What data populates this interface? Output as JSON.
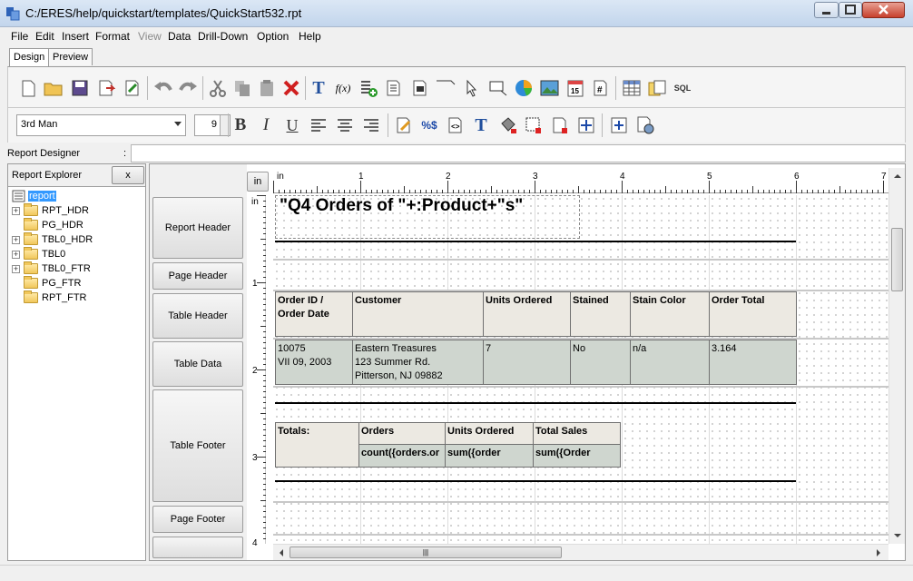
{
  "window": {
    "title": "C:/ERES/help/quickstart/templates/QuickStart532.rpt"
  },
  "menu": [
    {
      "label": "File",
      "enabled": true
    },
    {
      "label": "Edit",
      "enabled": true
    },
    {
      "label": "Insert",
      "enabled": true
    },
    {
      "label": "Format",
      "enabled": true
    },
    {
      "label": "View",
      "enabled": false
    },
    {
      "label": "Data",
      "enabled": true
    },
    {
      "label": "Drill-Down",
      "enabled": true
    },
    {
      "label": "Option",
      "enabled": true
    },
    {
      "label": "Help",
      "enabled": true
    }
  ],
  "tabs": [
    {
      "label": "Design",
      "active": true
    },
    {
      "label": "Preview",
      "active": false
    }
  ],
  "toolbar1": [
    "new-file-icon",
    "open-folder-icon",
    "save-icon",
    "export-icon",
    "edit-page-icon",
    "undo-icon",
    "redo-icon",
    "cut-icon",
    "copy-icon",
    "paste-icon",
    "delete-icon",
    "text-icon",
    "formula-icon",
    "add-column-icon",
    "page-icon",
    "insert-page-icon",
    "line-icon",
    "pointer-icon",
    "rectangle-icon",
    "pie-chart-icon",
    "image-icon",
    "date-icon",
    "page-number-icon",
    "table-icon",
    "query-icon",
    "sql-icon"
  ],
  "toolbar2": {
    "font": "3rd Man",
    "size": "9",
    "buttons": [
      "bold-icon",
      "italic-icon",
      "underline-icon",
      "align-left-icon",
      "align-center-icon",
      "align-right-icon",
      "edit-format-icon",
      "percent-dollar-icon",
      "script-icon",
      "text-color-icon",
      "fill-color-icon",
      "border-icon",
      "page-border-icon",
      "move-icon",
      "fit-icon",
      "settings-icon"
    ]
  },
  "designer_bar": {
    "label": "Report Designer",
    "colon": ":",
    "value": ""
  },
  "explorer": {
    "title": "Report Explorer",
    "close_label": "x",
    "root": "report",
    "nodes": [
      {
        "label": "RPT_HDR",
        "expandable": true
      },
      {
        "label": "PG_HDR",
        "expandable": false
      },
      {
        "label": "TBL0_HDR",
        "expandable": true
      },
      {
        "label": "TBL0",
        "expandable": true
      },
      {
        "label": "TBL0_FTR",
        "expandable": true
      },
      {
        "label": "PG_FTR",
        "expandable": false
      },
      {
        "label": "RPT_FTR",
        "expandable": false
      }
    ]
  },
  "sections": [
    "Report Header",
    "Page Header",
    "Table Header",
    "Table Data",
    "Table Footer",
    "Page Footer"
  ],
  "unit_button": "in",
  "ruler": {
    "h_labels": [
      "in",
      "1",
      "2",
      "3",
      "4",
      "5",
      "6",
      "7"
    ],
    "v_labels": [
      "in",
      "1",
      "2",
      "3",
      "4"
    ]
  },
  "report": {
    "title": "\"Q4 Orders of \"+:Product+\"s\"",
    "table_header": [
      {
        "l1": "Order ID /",
        "l2": "Order Date"
      },
      {
        "l1": "Customer",
        "l2": ""
      },
      {
        "l1": "Units Ordered",
        "l2": ""
      },
      {
        "l1": "Stained",
        "l2": ""
      },
      {
        "l1": "Stain Color",
        "l2": ""
      },
      {
        "l1": "Order Total",
        "l2": ""
      }
    ],
    "table_data": [
      {
        "l1": "10075",
        "l2": "VII 09, 2003",
        "l3": ""
      },
      {
        "l1": "Eastern Treasures",
        "l2": "123 Summer Rd.",
        "l3": "Pitterson, NJ 09882"
      },
      {
        "l1": "7",
        "l2": "",
        "l3": ""
      },
      {
        "l1": "No",
        "l2": "",
        "l3": ""
      },
      {
        "l1": "n/a",
        "l2": "",
        "l3": ""
      },
      {
        "l1": "3.164",
        "l2": "",
        "l3": ""
      }
    ],
    "footer_labels": {
      "totals": "Totals:",
      "orders": "Orders",
      "units": "Units Ordered",
      "sales": "Total Sales"
    },
    "footer_values": {
      "orders": "count({orders.or",
      "units": "sum({order",
      "sales": "sum({Order"
    }
  }
}
